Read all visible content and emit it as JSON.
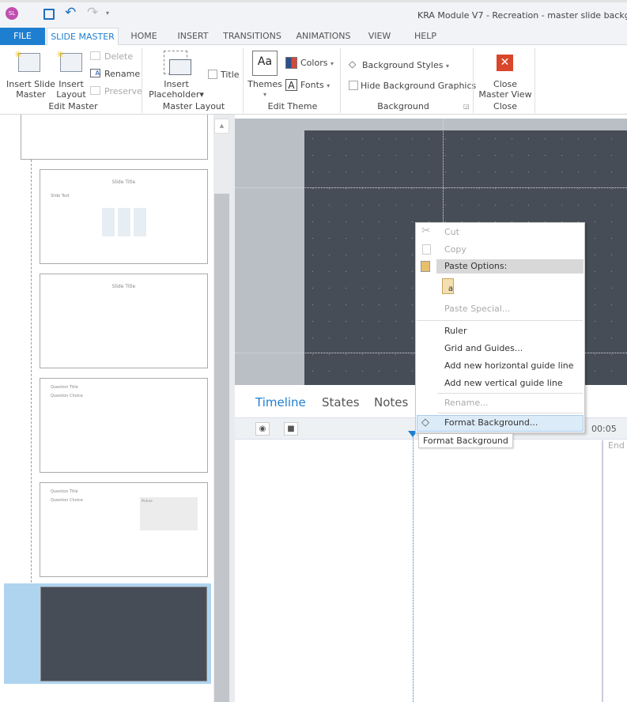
{
  "app": {
    "user_initials": "SL",
    "title": "KRA Module V7 - Recreation - master slide backgrou"
  },
  "tabs": [
    "FILE",
    "SLIDE MASTER",
    "HOME",
    "INSERT",
    "TRANSITIONS",
    "ANIMATIONS",
    "VIEW",
    "HELP"
  ],
  "ribbon": {
    "edit_master": {
      "insert_slide_master": [
        "Insert Slide",
        "Master"
      ],
      "insert_layout": [
        "Insert",
        "Layout"
      ],
      "delete": "Delete",
      "rename": "Rename",
      "preserve": "Preserve",
      "label": "Edit Master"
    },
    "master_layout": {
      "insert_placeholder": [
        "Insert",
        "Placeholder"
      ],
      "title": "Title",
      "label": "Master Layout"
    },
    "edit_theme": {
      "themes": "Themes",
      "themes_icon": "Aa",
      "colors": "Colors",
      "fonts": "Fonts",
      "label": "Edit Theme"
    },
    "background": {
      "styles": "Background Styles",
      "hide": "Hide Background Graphics",
      "label": "Background"
    },
    "close": {
      "close_master": [
        "Close",
        "Master View"
      ],
      "label": "Close"
    }
  },
  "thumbnails": [
    {
      "title": "Slide Title",
      "body": "Slide Text"
    },
    {
      "title": "Slide Title"
    },
    {
      "title": "Question Title",
      "body": "Question Choice"
    },
    {
      "title": "Question Title",
      "body": "Question Choice",
      "picture": "Picture"
    }
  ],
  "timeline": {
    "tabs": [
      "Timeline",
      "States",
      "Notes"
    ],
    "time": "00:05",
    "end": "End"
  },
  "context_menu": {
    "items": [
      "Cut",
      "Copy",
      "Paste Options:",
      "Paste Special...",
      "Ruler",
      "Grid and Guides...",
      "Add new horizontal guide line",
      "Add new vertical guide line",
      "Rename...",
      "Format Background..."
    ]
  },
  "tooltip": "Format Background",
  "colors": {
    "accent": "#1e7fd1",
    "file_tab": "#1e7fd1",
    "slide_bg": "#474d57",
    "close_red": "#d9472b"
  }
}
